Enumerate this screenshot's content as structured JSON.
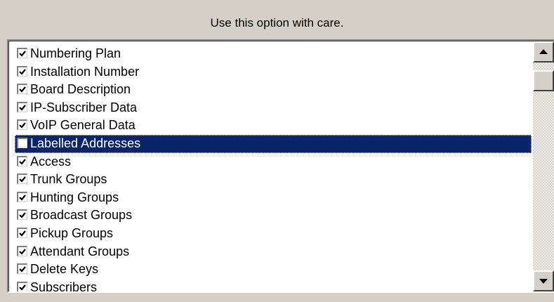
{
  "header": {
    "note": "Use this option with care."
  },
  "items": [
    {
      "label": "Numbering Plan",
      "checked": true,
      "selected": false
    },
    {
      "label": "Installation Number",
      "checked": true,
      "selected": false
    },
    {
      "label": "Board Description",
      "checked": true,
      "selected": false
    },
    {
      "label": "IP-Subscriber Data",
      "checked": true,
      "selected": false
    },
    {
      "label": "VoIP General Data",
      "checked": true,
      "selected": false
    },
    {
      "label": "Labelled Addresses",
      "checked": false,
      "selected": true
    },
    {
      "label": "Access",
      "checked": true,
      "selected": false
    },
    {
      "label": "Trunk Groups",
      "checked": true,
      "selected": false
    },
    {
      "label": "Hunting Groups",
      "checked": true,
      "selected": false
    },
    {
      "label": "Broadcast Groups",
      "checked": true,
      "selected": false
    },
    {
      "label": "Pickup Groups",
      "checked": true,
      "selected": false
    },
    {
      "label": "Attendant Groups",
      "checked": true,
      "selected": false
    },
    {
      "label": "Delete Keys",
      "checked": true,
      "selected": false
    },
    {
      "label": "Subscribers",
      "checked": true,
      "selected": false
    }
  ],
  "scrollbar": {
    "position": 0.04,
    "up_icon": "arrow-up-icon",
    "down_icon": "arrow-down-icon"
  },
  "colors": {
    "selection": "#0a246a",
    "window": "#d4d0c8"
  }
}
